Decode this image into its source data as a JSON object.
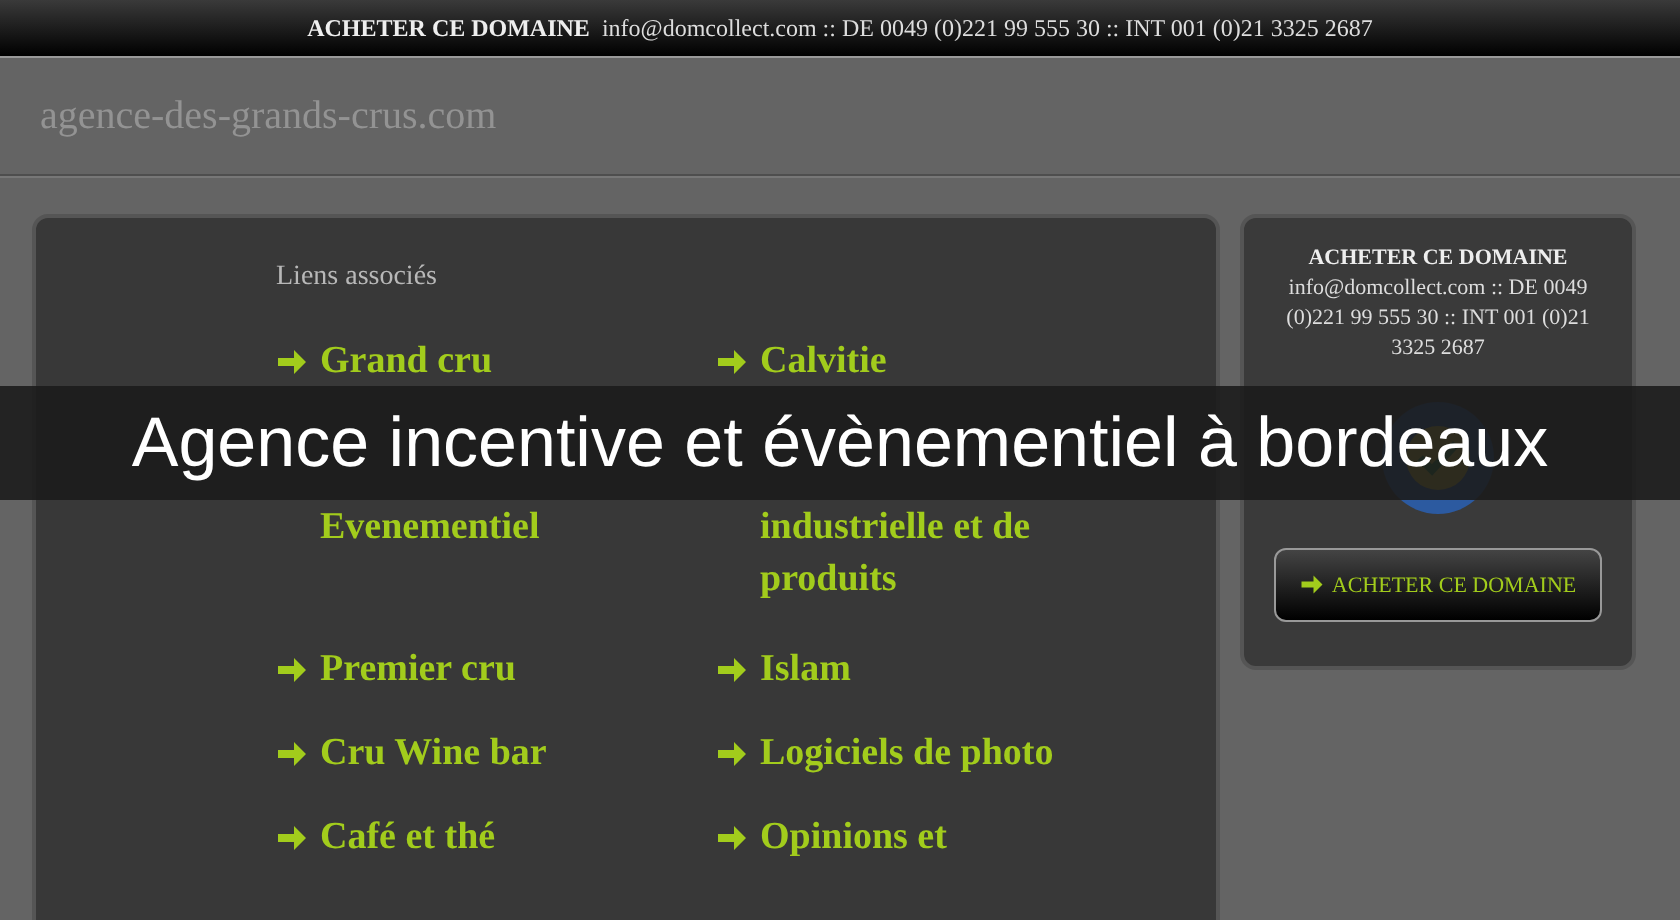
{
  "top_bar": {
    "label": "ACHETER CE DOMAINE",
    "contact": "info@domcollect.com :: DE 0049 (0)221 99 555 30 :: INT 001 (0)21 3325 2687"
  },
  "site_title": "agence-des-grands-crus.com",
  "related": {
    "heading": "Liens associés",
    "links": [
      {
        "text": "Grand cru",
        "covered": false
      },
      {
        "text": "Calvitie",
        "covered": false
      },
      {
        "text": "Evenementiel",
        "covered": true
      },
      {
        "text": "industrielle et de produits",
        "covered": true
      },
      {
        "text": "Premier cru",
        "covered": false
      },
      {
        "text": "Islam",
        "covered": false
      },
      {
        "text": "Cru Wine bar",
        "covered": false
      },
      {
        "text": "Logiciels de photo",
        "covered": false
      },
      {
        "text": "Café et thé",
        "covered": false
      },
      {
        "text": "Opinions et",
        "covered": false
      }
    ]
  },
  "sidebar": {
    "title": "ACHETER CE DOMAINE",
    "contact": "info@domcollect.com :: DE 0049 (0)221 99 555 30 :: INT 001 (0)21 3325 2687",
    "button": "ACHETER CE DOMAINE"
  },
  "banner": "Agence incentive et évènementiel à bordeaux"
}
